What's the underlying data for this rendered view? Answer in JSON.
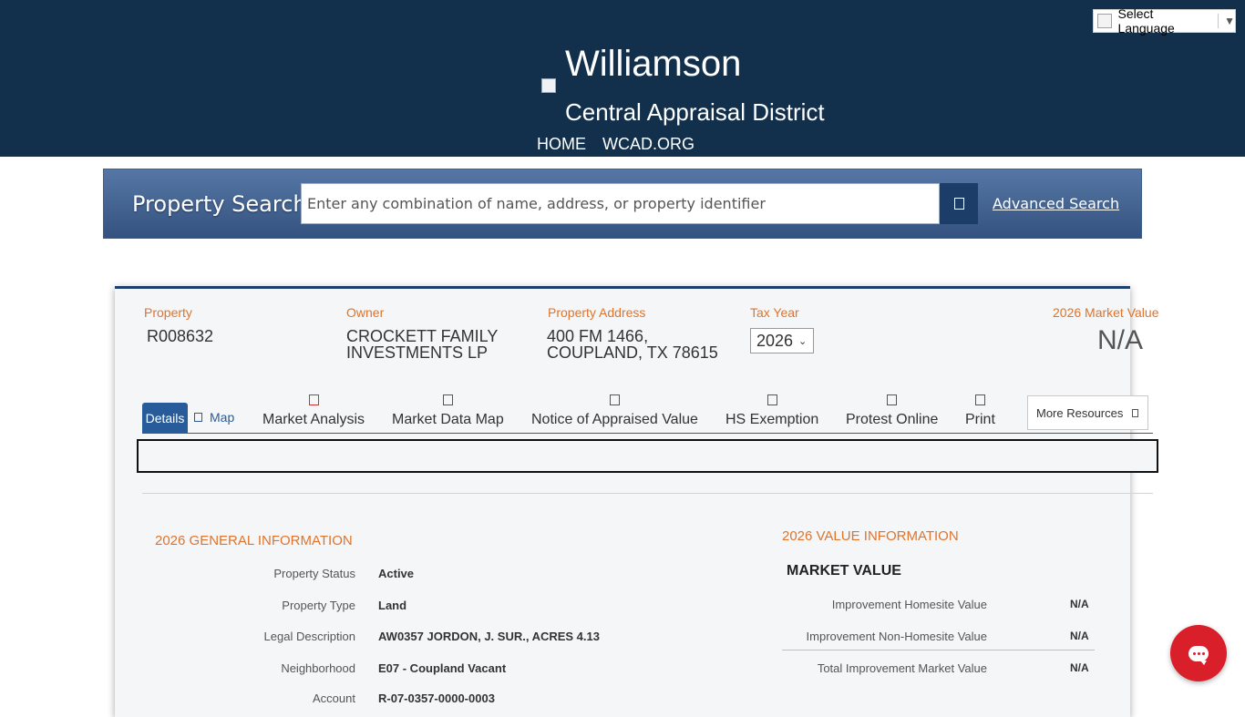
{
  "header": {
    "title_main": "Williamson",
    "title_sub": "Central Appraisal District",
    "nav": [
      "HOME",
      "WCAD.ORG"
    ],
    "language": {
      "label": "Select Language",
      "arrow": "▼"
    }
  },
  "search": {
    "title": "Property Search",
    "placeholder": "Enter any combination of name, address, or property identifier",
    "button_icon": "search-icon",
    "advanced_label": "Advanced Search"
  },
  "property": {
    "labels": {
      "property": "Property",
      "owner": "Owner",
      "address": "Property Address",
      "tax_year": "Tax Year",
      "market_value": "2026 Market Value"
    },
    "id": "R008632",
    "owner_line1": "CROCKETT FAMILY",
    "owner_line2": "INVESTMENTS LP",
    "address_line1": "400 FM 1466,",
    "address_line2": "COUPLAND, TX 78615",
    "tax_year": "2026",
    "market_value": "N/A"
  },
  "tabs": {
    "details": "Details",
    "map": "Map",
    "tools": [
      {
        "label": "Market Analysis",
        "icon": "chart-icon"
      },
      {
        "label": "Market Data Map",
        "icon": "map-icon"
      },
      {
        "label": "Notice of Appraised Value",
        "icon": "document-icon"
      },
      {
        "label": "HS Exemption",
        "icon": "home-icon"
      },
      {
        "label": "Protest Online",
        "icon": "gavel-icon"
      },
      {
        "label": "Print",
        "icon": "print-icon"
      }
    ],
    "more_resources": "More Resources"
  },
  "general": {
    "heading": "2026 GENERAL INFORMATION",
    "rows": [
      {
        "label": "Property Status",
        "value": "Active"
      },
      {
        "label": "Property Type",
        "value": "Land"
      },
      {
        "label": "Legal Description",
        "value": "AW0357 JORDON, J. SUR., ACRES 4.13"
      },
      {
        "label": "Neighborhood",
        "value": "E07 - Coupland Vacant"
      },
      {
        "label": "Account",
        "value": "R-07-0357-0000-0003"
      }
    ]
  },
  "value_info": {
    "heading": "2026 VALUE INFORMATION",
    "subheading": "MARKET VALUE",
    "rows": [
      {
        "label": "Improvement Homesite Value",
        "value": "N/A"
      },
      {
        "label": "Improvement Non-Homesite Value",
        "value": "N/A"
      },
      {
        "label": "Total Improvement Market Value",
        "value": "N/A"
      }
    ]
  },
  "colors": {
    "header_bg": "#12304c",
    "accent_orange": "#e0742b",
    "tab_blue": "#285b99",
    "chat_red": "#d81f2a"
  }
}
